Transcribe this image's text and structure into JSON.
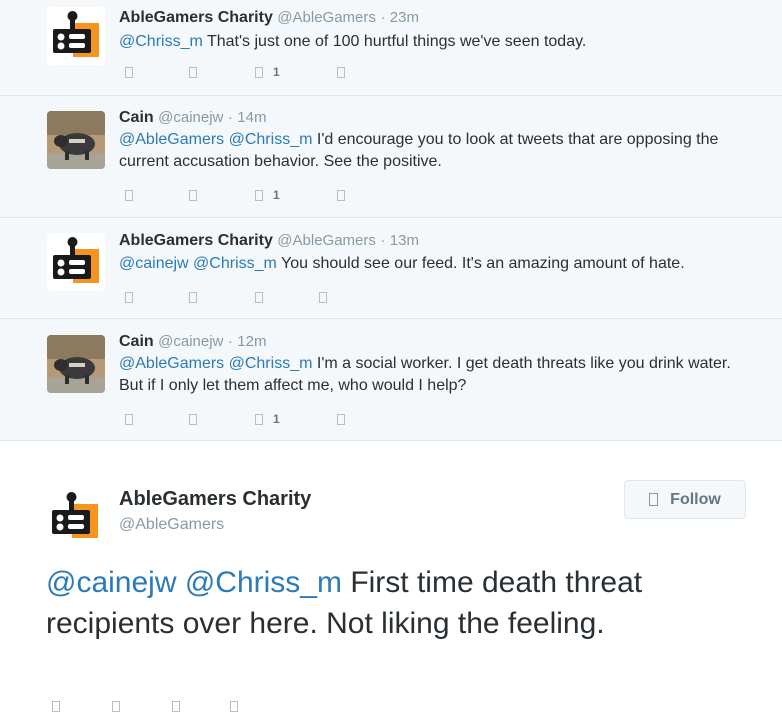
{
  "replies": [
    {
      "name": "AbleGamers Charity",
      "handle": "@AbleGamers",
      "time": "23m",
      "avatar": "ablegamers-joystick-logo",
      "mentions": "@Chriss_m",
      "body": " That's just one of 100 hurtful things we've seen today.",
      "retweet_count": "1"
    },
    {
      "name": "Cain",
      "handle": "@cainejw",
      "time": "14m",
      "avatar": "pig-photo",
      "mentions": "@AbleGamers @Chriss_m",
      "body": " I'd encourage you to look at tweets that are opposing the current accusation behavior. See the positive.",
      "retweet_count": "1"
    },
    {
      "name": "AbleGamers Charity",
      "handle": "@AbleGamers",
      "time": "13m",
      "avatar": "ablegamers-joystick-logo",
      "mentions": "@cainejw @Chriss_m",
      "body": " You should see our feed. It's an amazing amount of hate.",
      "retweet_count": ""
    },
    {
      "name": "Cain",
      "handle": "@cainejw",
      "time": "12m",
      "avatar": "pig-photo",
      "mentions": "@AbleGamers @Chriss_m",
      "body": " I'm a social worker. I get death threats like you drink water. But if I only let them affect me, who would I help?",
      "retweet_count": "1"
    }
  ],
  "separator": "·",
  "main": {
    "name": "AbleGamers Charity",
    "handle": "@AbleGamers",
    "follow_label": "Follow",
    "mentions": "@cainejw @Chriss_m",
    "body": " First time death threat recipients over here. Not liking the feeling."
  },
  "icons": [
    "reply-icon",
    "retweet-icon",
    "favorite-icon",
    "more-icon",
    "follow-icon"
  ],
  "colors": {
    "mention": "#2b7bb9",
    "thread_bg": "#f5f8fa",
    "logo_orange": "#f7941d"
  }
}
